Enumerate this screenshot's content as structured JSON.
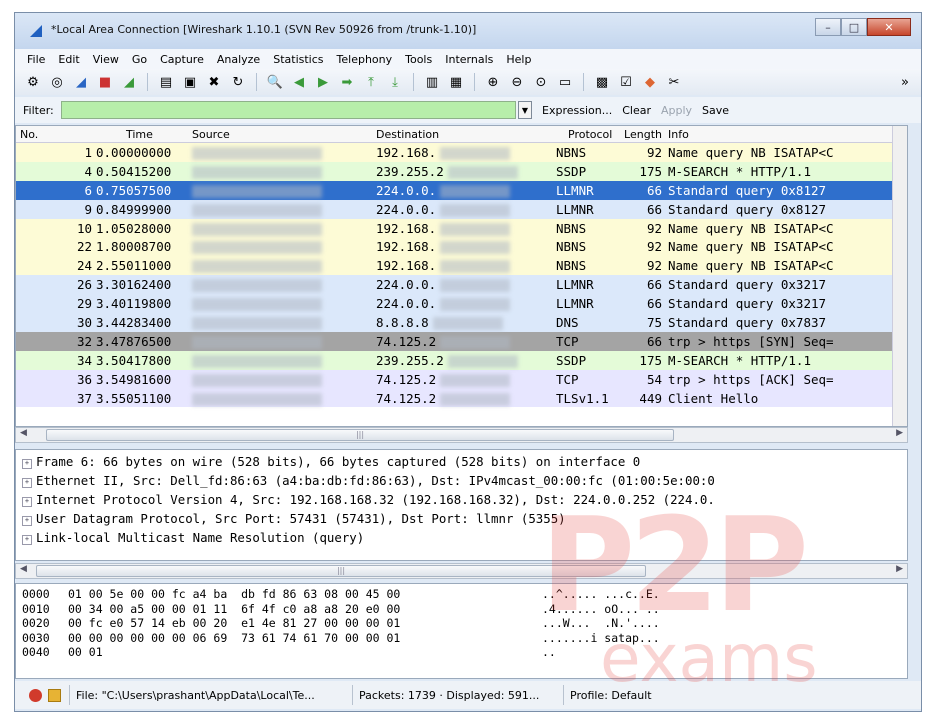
{
  "window": {
    "title": "*Local Area Connection   [Wireshark 1.10.1  (SVN Rev 50926 from /trunk-1.10)]",
    "controls": {
      "minimize": "–",
      "maximize": "□",
      "close": "✕"
    }
  },
  "menu": [
    "File",
    "Edit",
    "View",
    "Go",
    "Capture",
    "Analyze",
    "Statistics",
    "Telephony",
    "Tools",
    "Internals",
    "Help"
  ],
  "filterbar": {
    "label": "Filter:",
    "value": "",
    "expression": "Expression...",
    "clear": "Clear",
    "apply": "Apply",
    "save": "Save"
  },
  "columns": [
    "No.",
    "Time",
    "Source",
    "Destination",
    "Protocol",
    "Length",
    "Info"
  ],
  "packets": [
    {
      "no": "1",
      "time": "0.00000000",
      "destination": "192.168.",
      "protocol": "NBNS",
      "length": "92",
      "info": "Name query NB ISATAP<C",
      "bg": "#fdfbd6",
      "fg": "#000000"
    },
    {
      "no": "4",
      "time": "0.50415200",
      "destination": "239.255.2",
      "protocol": "SSDP",
      "length": "175",
      "info": "M-SEARCH * HTTP/1.1",
      "bg": "#e4fbd8",
      "fg": "#000000"
    },
    {
      "no": "6",
      "time": "0.75057500",
      "destination": "224.0.0.",
      "protocol": "LLMNR",
      "length": "66",
      "info": "Standard query 0x8127",
      "bg": "#2f6fcc",
      "fg": "#ffffff"
    },
    {
      "no": "9",
      "time": "0.84999900",
      "destination": "224.0.0.",
      "protocol": "LLMNR",
      "length": "66",
      "info": "Standard query 0x8127",
      "bg": "#dbe8fa",
      "fg": "#000000"
    },
    {
      "no": "10",
      "time": "1.05028000",
      "destination": "192.168.",
      "protocol": "NBNS",
      "length": "92",
      "info": "Name query NB ISATAP<C",
      "bg": "#fdfbd6",
      "fg": "#000000"
    },
    {
      "no": "22",
      "time": "1.80008700",
      "destination": "192.168.",
      "protocol": "NBNS",
      "length": "92",
      "info": "Name query NB ISATAP<C",
      "bg": "#fdfbd6",
      "fg": "#000000"
    },
    {
      "no": "24",
      "time": "2.55011000",
      "destination": "192.168.",
      "protocol": "NBNS",
      "length": "92",
      "info": "Name query NB ISATAP<C",
      "bg": "#fdfbd6",
      "fg": "#000000"
    },
    {
      "no": "26",
      "time": "3.30162400",
      "destination": "224.0.0.",
      "protocol": "LLMNR",
      "length": "66",
      "info": "Standard query 0x3217",
      "bg": "#dbe8fa",
      "fg": "#000000"
    },
    {
      "no": "29",
      "time": "3.40119800",
      "destination": "224.0.0.",
      "protocol": "LLMNR",
      "length": "66",
      "info": "Standard query 0x3217",
      "bg": "#dbe8fa",
      "fg": "#000000"
    },
    {
      "no": "30",
      "time": "3.44283400",
      "destination": "8.8.8.8",
      "protocol": "DNS",
      "length": "75",
      "info": "Standard query 0x7837",
      "bg": "#dbe8fa",
      "fg": "#000000"
    },
    {
      "no": "32",
      "time": "3.47876500",
      "destination": "74.125.2",
      "protocol": "TCP",
      "length": "66",
      "info": "trp > https [SYN] Seq=",
      "bg": "#a4a4a4",
      "fg": "#000000"
    },
    {
      "no": "34",
      "time": "3.50417800",
      "destination": "239.255.2",
      "protocol": "SSDP",
      "length": "175",
      "info": "M-SEARCH * HTTP/1.1",
      "bg": "#e4fbd8",
      "fg": "#000000"
    },
    {
      "no": "36",
      "time": "3.54981600",
      "destination": "74.125.2",
      "protocol": "TCP",
      "length": "54",
      "info": "trp > https [ACK] Seq=",
      "bg": "#e7e6ff",
      "fg": "#000000"
    },
    {
      "no": "37",
      "time": "3.55051100",
      "destination": "74.125.2",
      "protocol": "TLSv1.1",
      "length": "449",
      "info": "Client Hello",
      "bg": "#e7e6ff",
      "fg": "#000000"
    }
  ],
  "details": [
    "Frame 6: 66 bytes on wire (528 bits), 66 bytes captured (528 bits) on interface 0",
    "Ethernet II, Src: Dell_fd:86:63 (a4:ba:db:fd:86:63), Dst: IPv4mcast_00:00:fc (01:00:5e:00:0",
    "Internet Protocol Version 4, Src: 192.168.168.32 (192.168.168.32), Dst: 224.0.0.252 (224.0.",
    "User Datagram Protocol, Src Port: 57431 (57431), Dst Port: llmnr (5355)",
    "Link-local Multicast Name Resolution (query)"
  ],
  "hex": [
    {
      "offset": "0000",
      "bytes": "01 00 5e 00 00 fc a4 ba  db fd 86 63 08 00 45 00",
      "ascii": "..^..... ...c..E."
    },
    {
      "offset": "0010",
      "bytes": "00 34 00 a5 00 00 01 11  6f 4f c0 a8 a8 20 e0 00",
      "ascii": ".4...... oO... .."
    },
    {
      "offset": "0020",
      "bytes": "00 fc e0 57 14 eb 00 20  e1 4e 81 27 00 00 00 01",
      "ascii": "...W...  .N.'...."
    },
    {
      "offset": "0030",
      "bytes": "00 00 00 00 00 00 06 69  73 61 74 61 70 00 00 01",
      "ascii": ".......i satap..."
    },
    {
      "offset": "0040",
      "bytes": "00 01",
      "ascii": ".."
    }
  ],
  "status": {
    "file": "File: \"C:\\Users\\prashant\\AppData\\Local\\Te...",
    "packets": "Packets: 1739 · Displayed: 591...",
    "profile": "Profile: Default"
  },
  "watermark": "exams"
}
